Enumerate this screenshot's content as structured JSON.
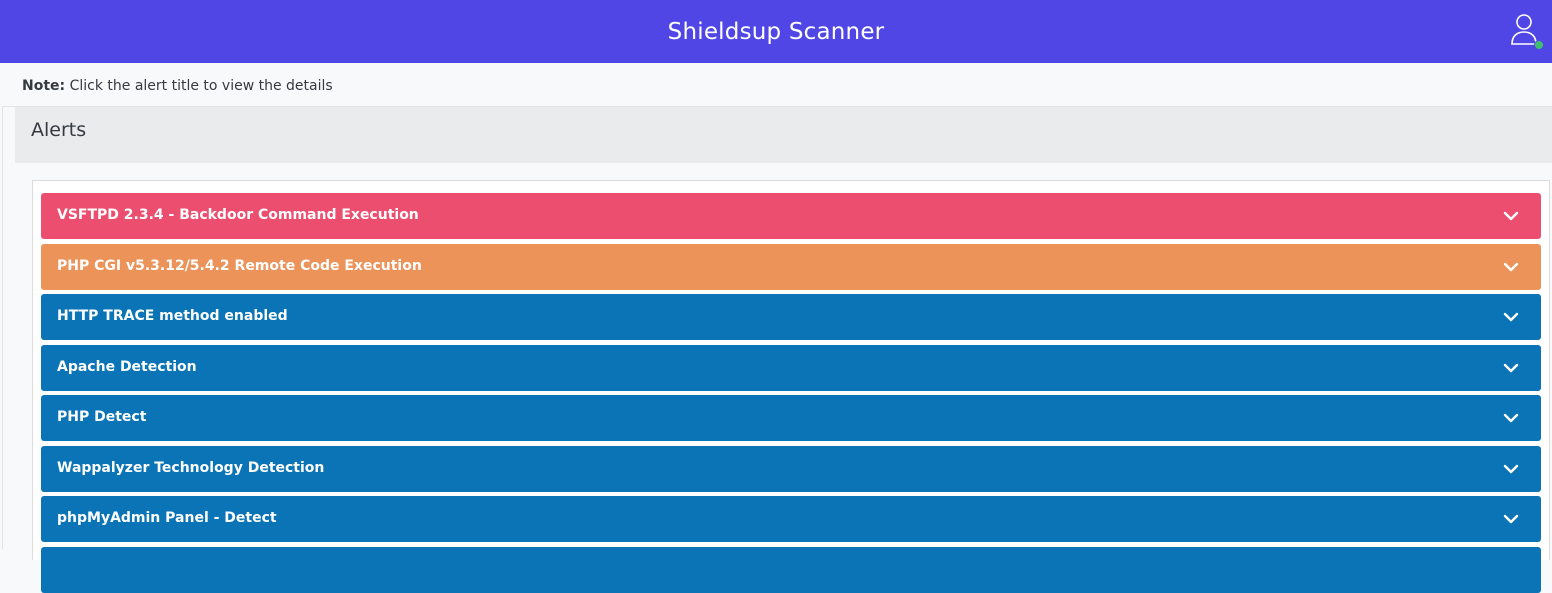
{
  "header": {
    "title": "Shieldsup Scanner",
    "user_icon": "user-icon",
    "status_color": "#3fbf6b",
    "bg_color": "#5046e5"
  },
  "note": {
    "label": "Note:",
    "text": "Click the alert title to view the details"
  },
  "alerts_panel": {
    "title": "Alerts",
    "items": [
      {
        "title": "VSFTPD 2.3.4 - Backdoor Command Execution",
        "color": "#ec4e6f",
        "icon": "chevron-down-icon"
      },
      {
        "title": "PHP CGI v5.3.12/5.4.2 Remote Code Execution",
        "color": "#ec935a",
        "icon": "chevron-down-icon"
      },
      {
        "title": "HTTP TRACE method enabled",
        "color": "#0b74b7",
        "icon": "chevron-down-icon"
      },
      {
        "title": "Apache Detection",
        "color": "#0b74b7",
        "icon": "chevron-down-icon"
      },
      {
        "title": "PHP Detect",
        "color": "#0b74b7",
        "icon": "chevron-down-icon"
      },
      {
        "title": "Wappalyzer Technology Detection",
        "color": "#0b74b7",
        "icon": "chevron-down-icon"
      },
      {
        "title": "phpMyAdmin Panel - Detect",
        "color": "#0b74b7",
        "icon": "chevron-down-icon"
      },
      {
        "title": "",
        "color": "#0b74b7",
        "icon": "chevron-down-icon"
      }
    ]
  }
}
